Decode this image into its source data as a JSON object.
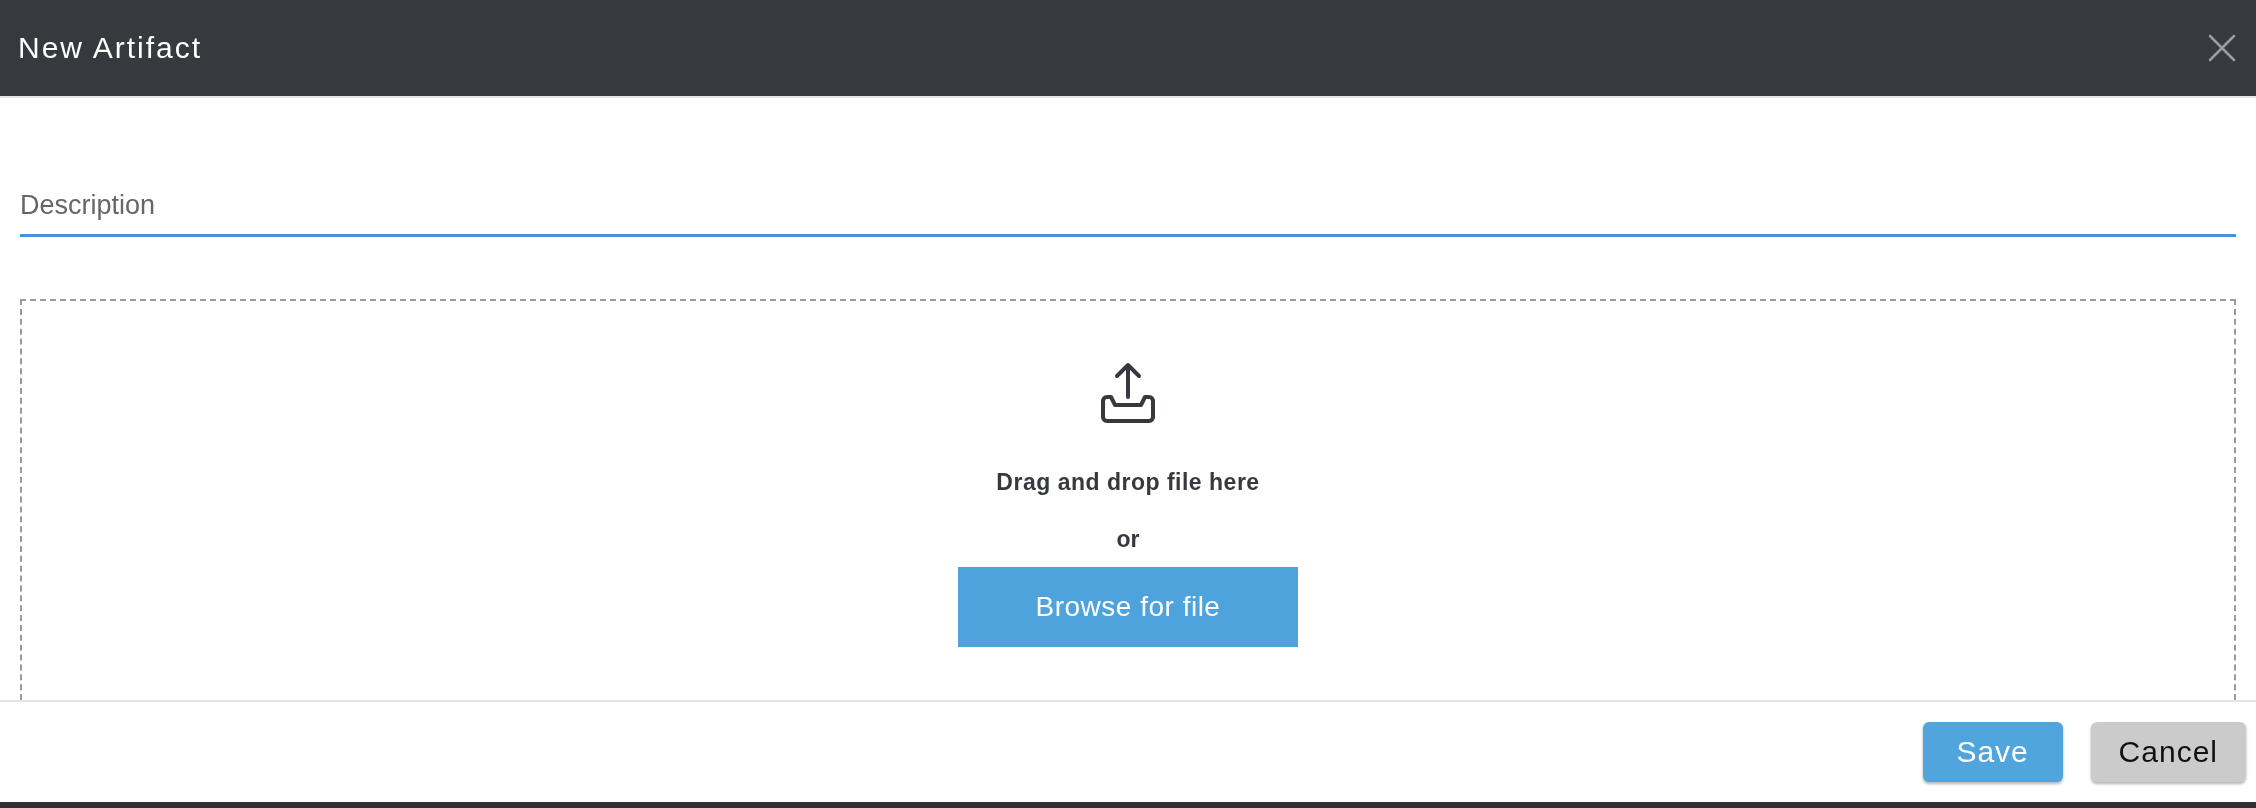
{
  "dialog": {
    "title": "New Artifact"
  },
  "description_field": {
    "placeholder": "Description"
  },
  "dropzone": {
    "prompt": "Drag and drop file here",
    "separator": "or",
    "browse_button": "Browse for file"
  },
  "footer_buttons": [
    {
      "label": "Save",
      "kind": "primary"
    },
    {
      "label": "Cancel",
      "kind": "secondary"
    }
  ]
}
